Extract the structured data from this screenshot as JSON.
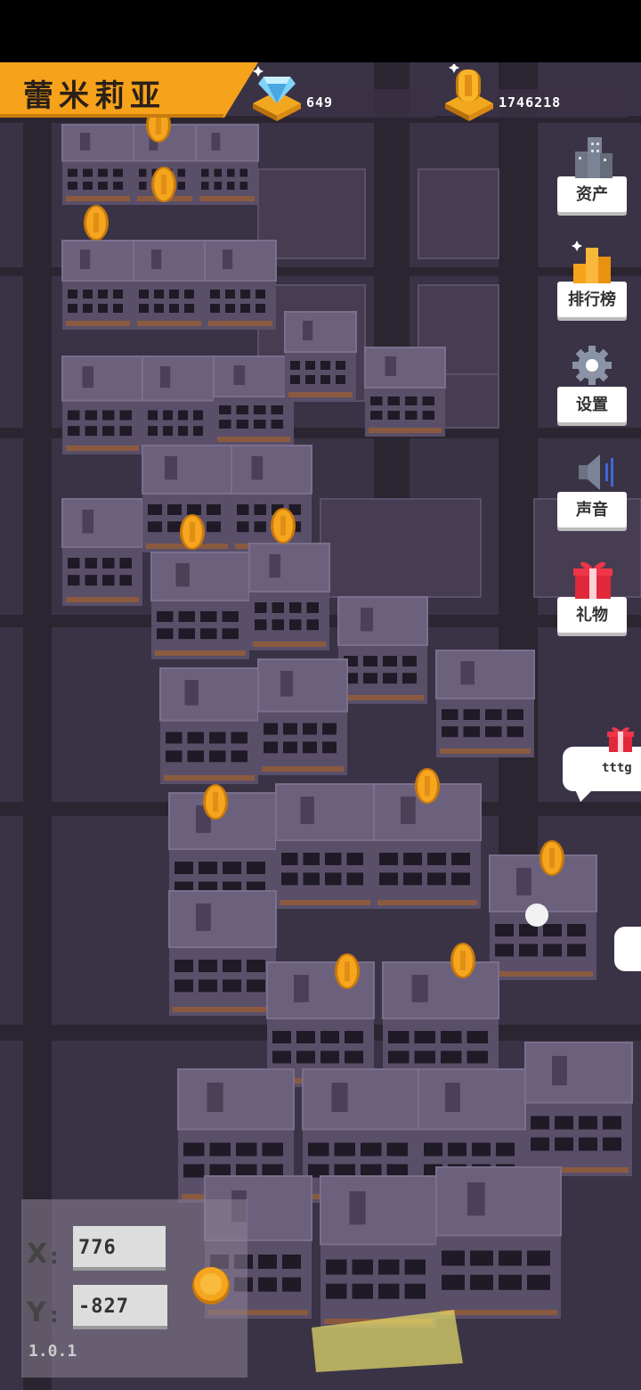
{
  "player": {
    "name": "蕾米莉亚"
  },
  "resources": {
    "diamonds": {
      "icon": "diamond-icon",
      "value": "649"
    },
    "coins": {
      "icon": "coin-icon",
      "value": "1746218"
    }
  },
  "menu": [
    {
      "id": "assets",
      "label": "资产",
      "icon": "buildings-icon"
    },
    {
      "id": "leaderboard",
      "label": "排行榜",
      "icon": "bar-chart-icon"
    },
    {
      "id": "settings",
      "label": "设置",
      "icon": "gear-icon"
    },
    {
      "id": "sound",
      "label": "声音",
      "icon": "speaker-icon"
    },
    {
      "id": "gift",
      "label": "礼物",
      "icon": "gift-box-icon"
    }
  ],
  "chat": {
    "text": "tttg",
    "icon": "gift-box-icon"
  },
  "coords": {
    "x_label": "X",
    "x_value": "776",
    "y_label": "Y",
    "y_value": "-827"
  },
  "version": "1.0.1",
  "colors": {
    "banner": "#f7a21b",
    "ground": "#4a4258",
    "building": "#6a5f7a",
    "coin": "#f6a51f"
  }
}
